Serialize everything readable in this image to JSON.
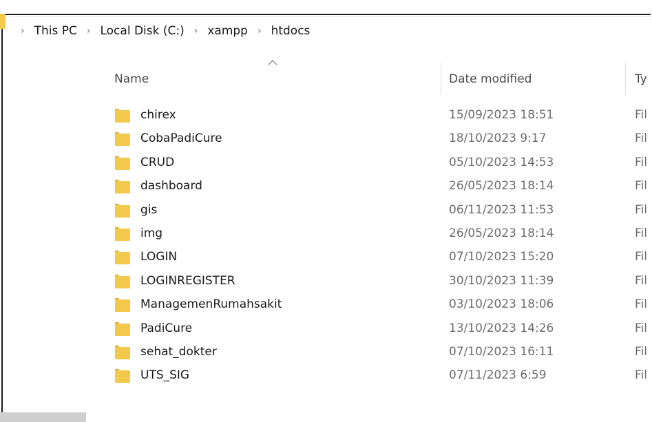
{
  "breadcrumb": {
    "items": [
      "This PC",
      "Local Disk (C:)",
      "xampp",
      "htdocs"
    ]
  },
  "columns": {
    "name": "Name",
    "date_modified": "Date modified",
    "type": "Ty"
  },
  "files": [
    {
      "name": "chirex",
      "date": "15/09/2023 18:51",
      "type": "Fil"
    },
    {
      "name": "CobaPadiCure",
      "date": "18/10/2023 9:17",
      "type": "Fil"
    },
    {
      "name": "CRUD",
      "date": "05/10/2023 14:53",
      "type": "Fil"
    },
    {
      "name": "dashboard",
      "date": "26/05/2023 18:14",
      "type": "Fil"
    },
    {
      "name": "gis",
      "date": "06/11/2023 11:53",
      "type": "Fil"
    },
    {
      "name": "img",
      "date": "26/05/2023 18:14",
      "type": "Fil"
    },
    {
      "name": "LOGIN",
      "date": "07/10/2023 15:20",
      "type": "Fil"
    },
    {
      "name": "LOGINREGISTER",
      "date": "30/10/2023 11:39",
      "type": "Fil"
    },
    {
      "name": "ManagemenRumahsakit",
      "date": "03/10/2023 18:06",
      "type": "Fil"
    },
    {
      "name": "PadiCure",
      "date": "13/10/2023 14:26",
      "type": "Fil"
    },
    {
      "name": "sehat_dokter",
      "date": "07/10/2023 16:11",
      "type": "Fil"
    },
    {
      "name": "UTS_SIG",
      "date": "07/11/2023 6:59",
      "type": "Fil"
    }
  ],
  "icons": {
    "folder": "folder-icon",
    "separator": "chevron-right-icon",
    "sort": "sort-ascending-icon"
  },
  "colors": {
    "folder": "#f2c94c",
    "folder_dark": "#e0b23a",
    "text": "#1a1a1a",
    "muted": "#6d6d6d"
  }
}
